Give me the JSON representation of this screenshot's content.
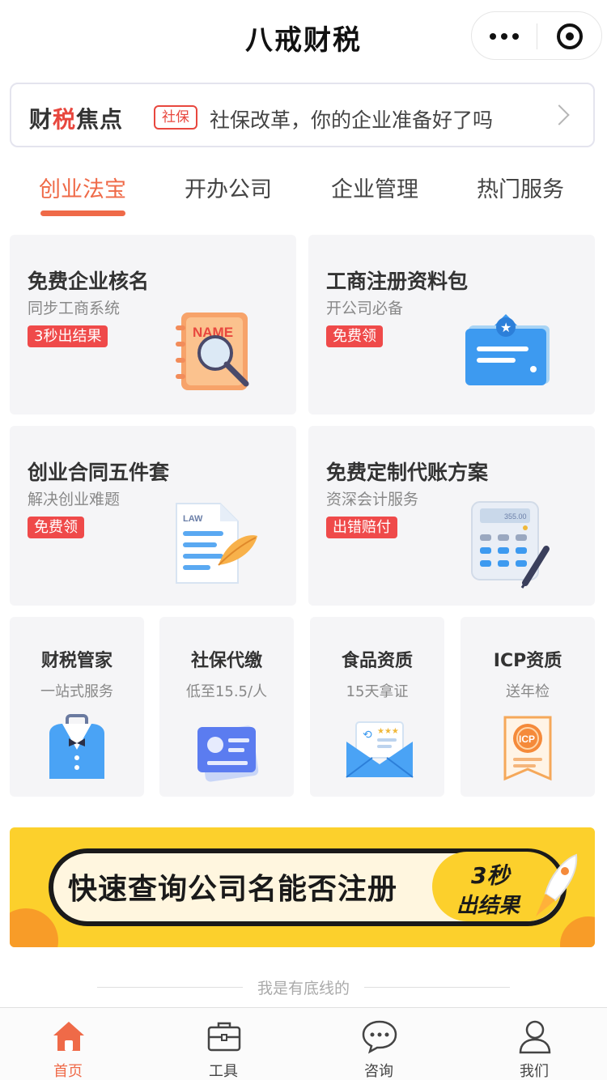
{
  "app": {
    "title": "八戒财税"
  },
  "news": {
    "brand_part1": "财",
    "brand_part2": "税",
    "brand_part3": "焦点",
    "tag": "社保",
    "text": "社保改革，你的企业准备好了吗"
  },
  "tabs": [
    {
      "label": "创业法宝",
      "active": true
    },
    {
      "label": "开办公司",
      "active": false
    },
    {
      "label": "企业管理",
      "active": false
    },
    {
      "label": "热门服务",
      "active": false
    }
  ],
  "big_cards": [
    {
      "title": "免费企业核名",
      "subtitle": "同步工商系统",
      "badge": "3秒出结果",
      "icon": "name-notebook-icon",
      "icon_text": "NAME"
    },
    {
      "title": "工商注册资料包",
      "subtitle": "开公司必备",
      "badge": "免费领",
      "icon": "certificate-card-icon"
    },
    {
      "title": "创业合同五件套",
      "subtitle": "解决创业难题",
      "badge": "免费领",
      "icon": "law-document-icon",
      "icon_text": "LAW"
    },
    {
      "title": "免费定制代账方案",
      "subtitle": "资深会计服务",
      "badge": "出错赔付",
      "icon": "calculator-icon",
      "icon_text": "355.00"
    }
  ],
  "small_cards": [
    {
      "title": "财税管家",
      "subtitle": "一站式服务",
      "icon": "butler-suit-icon"
    },
    {
      "title": "社保代缴",
      "subtitle": "低至15.5/人",
      "icon": "social-security-card-icon"
    },
    {
      "title": "食品资质",
      "subtitle": "15天拿证",
      "icon": "envelope-license-icon"
    },
    {
      "title": "ICP资质",
      "subtitle": "送年检",
      "icon": "icp-badge-icon",
      "icon_text": "ICP"
    }
  ],
  "banner": {
    "text": "快速查询公司名能否注册",
    "highlight_line1": "3秒",
    "highlight_line2": "出结果"
  },
  "divider_text": "我是有底线的",
  "tabbar": [
    {
      "label": "首页",
      "icon": "home-icon",
      "active": true
    },
    {
      "label": "工具",
      "icon": "toolbox-icon",
      "active": false
    },
    {
      "label": "咨询",
      "icon": "chat-bubble-icon",
      "active": false
    },
    {
      "label": "我们",
      "icon": "user-icon",
      "active": false
    }
  ],
  "colors": {
    "accent": "#ef6a48",
    "badge": "#ef4a4a",
    "banner": "#fcd02c"
  }
}
